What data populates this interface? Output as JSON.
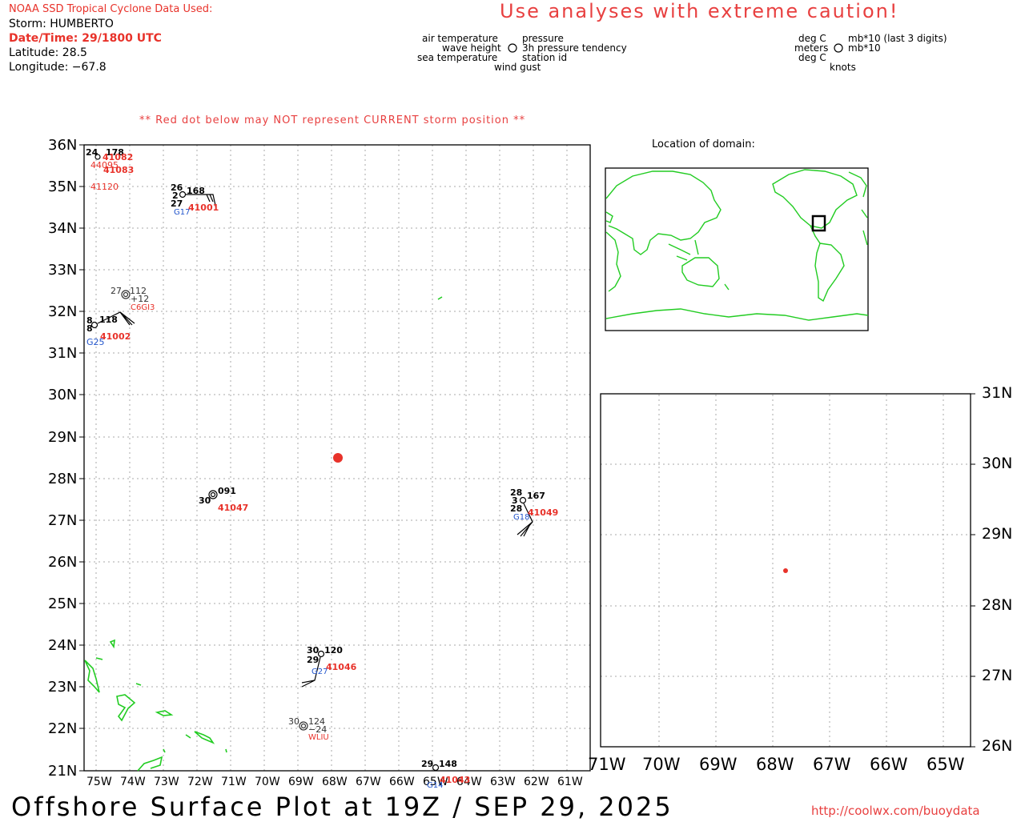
{
  "header": {
    "source": "NOAA SSD Tropical Cyclone Data Used:",
    "storm": "Storm: HUMBERTO",
    "datetime": "Date/Time: 29/1800 UTC",
    "latitude": "Latitude: 28.5",
    "longitude": "Longitude: −67.8",
    "caution": "Use analyses with extreme caution!"
  },
  "legend": {
    "air_temperature": "air temperature",
    "wave_height": "wave height",
    "sea_temperature": "sea temperature",
    "pressure": "pressure",
    "pressure_tendency": "3h pressure tendency",
    "station_id": "station id",
    "wind_gust": "wind gust",
    "deg_c_1": "deg C",
    "meters": "meters",
    "deg_c_2": "deg C",
    "mb_last3": "mb*10 (last 3 digits)",
    "mb10": "mb*10",
    "knots": "knots"
  },
  "warning": "** Red dot below may NOT represent CURRENT storm position **",
  "inset_title": "Location of domain:",
  "main_map": {
    "lat_labels": [
      "36N",
      "35N",
      "34N",
      "33N",
      "32N",
      "31N",
      "30N",
      "29N",
      "28N",
      "27N",
      "26N",
      "25N",
      "24N",
      "23N",
      "22N",
      "21N"
    ],
    "lon_labels": [
      "75W",
      "74W",
      "73W",
      "72W",
      "71W",
      "70W",
      "69W",
      "68W",
      "67W",
      "66W",
      "65W",
      "64W",
      "63W",
      "62W",
      "61W"
    ]
  },
  "zoom_map": {
    "lat_labels": [
      "31N",
      "30N",
      "29N",
      "28N",
      "27N",
      "26N"
    ],
    "lon_labels": [
      "71W",
      "70W",
      "69W",
      "68W",
      "67W",
      "66W",
      "65W"
    ]
  },
  "stations": {
    "s41082": {
      "top": "24",
      "pres": "178",
      "id": "41082"
    },
    "s44095": {
      "id": "44095"
    },
    "s41083": {
      "id": "41083"
    },
    "s41120": {
      "id": "41120"
    },
    "s41001": {
      "air": "26",
      "wave": "2",
      "sea": "27",
      "pres": "168",
      "gust": "G17",
      "id": "41001"
    },
    "sC6GI3": {
      "air": "27",
      "pres": "112",
      "tend": "+12",
      "id": "C6GI3"
    },
    "s41002": {
      "air": "8",
      "sea": "8",
      "pres": "118",
      "gust": "G25",
      "id": "41002"
    },
    "s41047": {
      "sea": "30",
      "pres": "091",
      "id": "41047"
    },
    "s41049": {
      "air": "28",
      "wave": "3",
      "sea": "28",
      "pres": "167",
      "gust": "G18",
      "id": "41049"
    },
    "s41046": {
      "air": "30",
      "sea": "29",
      "pres": "120",
      "gust": "G27",
      "id": "41046"
    },
    "sWLIU": {
      "air": "30",
      "pres": "124",
      "tend": "−24",
      "id": "WLIU"
    },
    "s41043": {
      "air": "29",
      "pres": "148",
      "gust": "G14",
      "id": "41043"
    }
  },
  "footer": "Offshore Surface Plot at 19Z / SEP 29, 2025",
  "url": "http://coolwx.com/buoydata",
  "colors": {
    "accent_red": "#e8322a",
    "land_green": "#22cc22",
    "gust_blue": "#2255cc"
  }
}
